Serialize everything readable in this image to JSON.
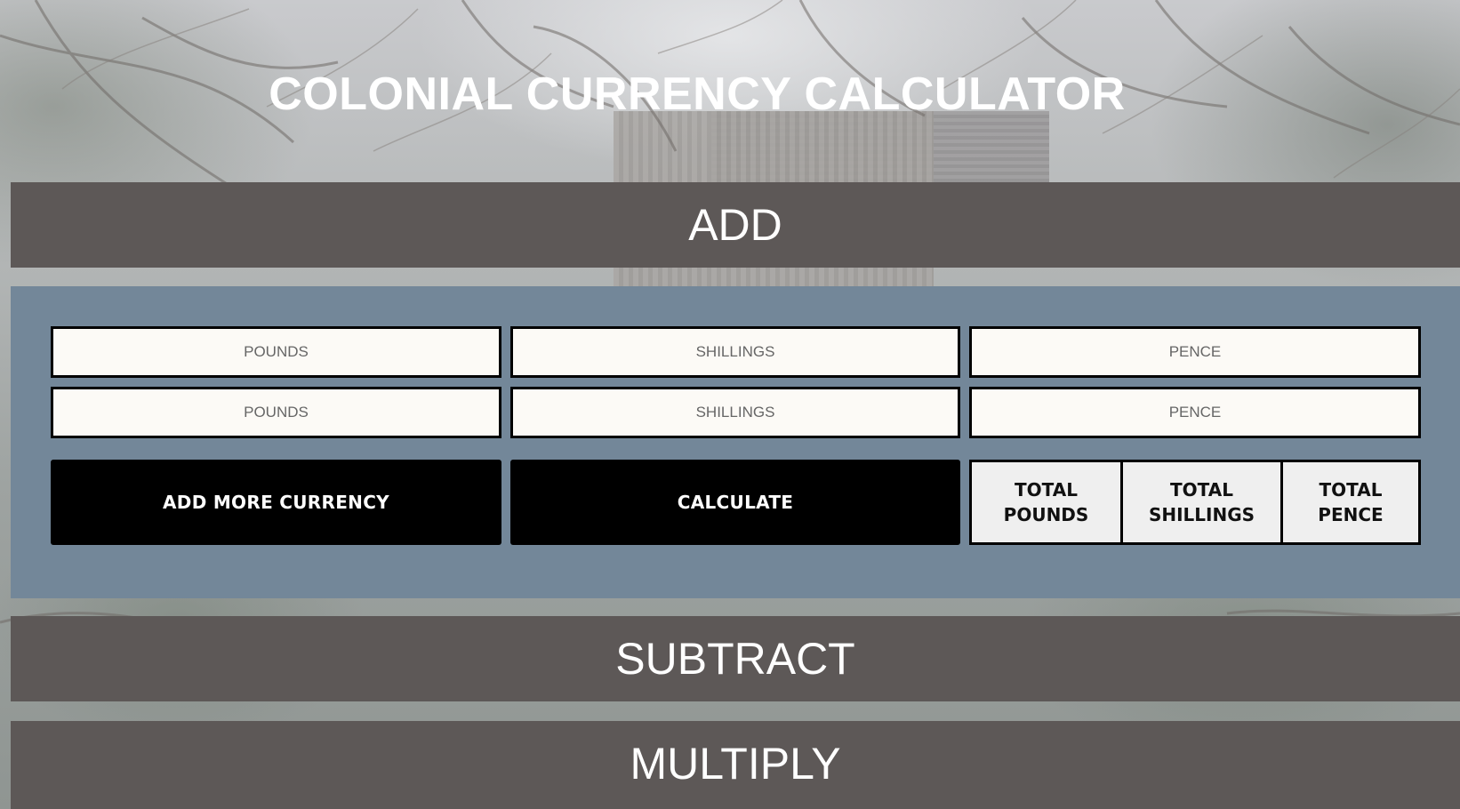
{
  "page": {
    "title": "COLONIAL CURRENCY CALCULATOR"
  },
  "sections": {
    "add": "ADD",
    "subtract": "SUBTRACT",
    "multiply": "MULTIPLY"
  },
  "add_form": {
    "rows": [
      {
        "pounds_placeholder": "POUNDS",
        "shillings_placeholder": "SHILLINGS",
        "pence_placeholder": "PENCE"
      },
      {
        "pounds_placeholder": "POUNDS",
        "shillings_placeholder": "SHILLINGS",
        "pence_placeholder": "PENCE"
      }
    ],
    "add_more_label": "ADD MORE CURRENCY",
    "calculate_label": "CALCULATE",
    "totals": {
      "pounds": "TOTAL\nPOUNDS",
      "shillings": "TOTAL\nSHILLINGS",
      "pence": "TOTAL\nPENCE"
    }
  },
  "colors": {
    "section_bar": "#5d5857",
    "panel": "#738799",
    "button": "#000000",
    "field_bg": "#fcfaf6"
  },
  "icons": {
    "background": "winter-barn-photo"
  }
}
